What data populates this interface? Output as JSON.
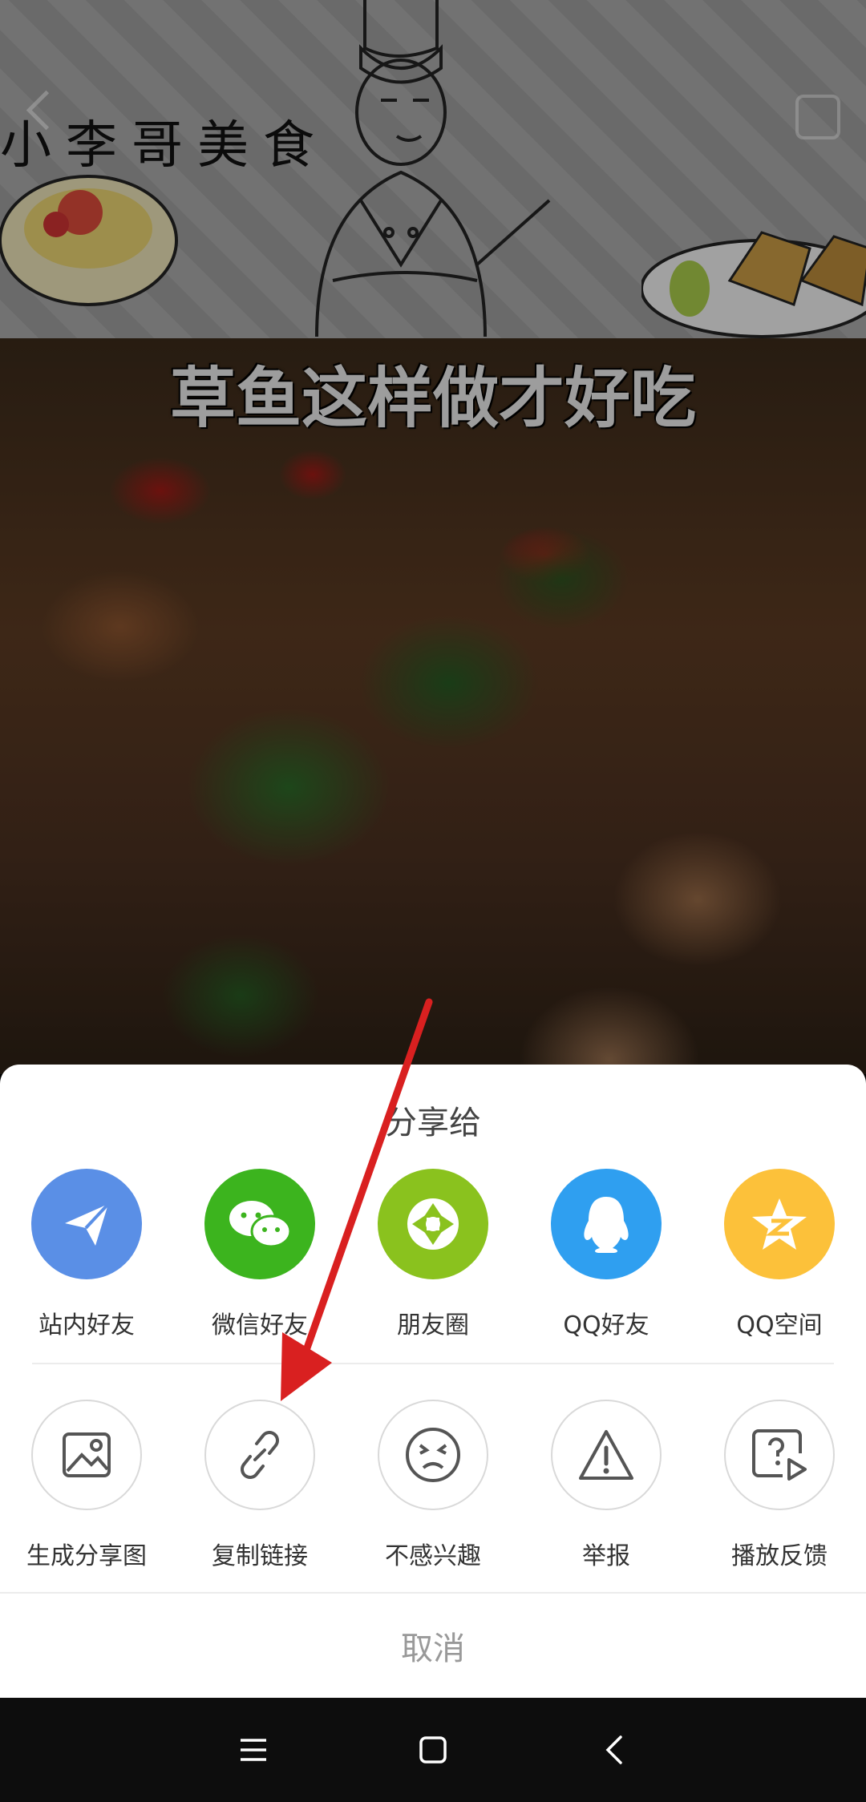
{
  "video": {
    "channel_name": "小李哥美食",
    "title": "草鱼这样做才好吃"
  },
  "share_sheet": {
    "title": "分享给",
    "row1": [
      {
        "label": "站内好友",
        "icon": "paper-plane-icon",
        "color": "#5a8fe6"
      },
      {
        "label": "微信好友",
        "icon": "wechat-icon",
        "color": "#3cb41e"
      },
      {
        "label": "朋友圈",
        "icon": "moments-icon",
        "color": "#8ac21e"
      },
      {
        "label": "QQ好友",
        "icon": "qq-icon",
        "color": "#2f9ff0"
      },
      {
        "label": "QQ空间",
        "icon": "qzone-icon",
        "color": "#fcc13a"
      }
    ],
    "row2": [
      {
        "label": "生成分享图",
        "icon": "image-icon"
      },
      {
        "label": "复制链接",
        "icon": "link-icon"
      },
      {
        "label": "不感兴趣",
        "icon": "unhappy-face-icon"
      },
      {
        "label": "举报",
        "icon": "warning-icon"
      },
      {
        "label": "播放反馈",
        "icon": "play-feedback-icon"
      }
    ],
    "cancel_label": "取消"
  },
  "annotation": {
    "arrow_color": "#d92020"
  },
  "navbar": {
    "buttons": [
      "menu-icon",
      "home-icon",
      "back-icon"
    ]
  }
}
